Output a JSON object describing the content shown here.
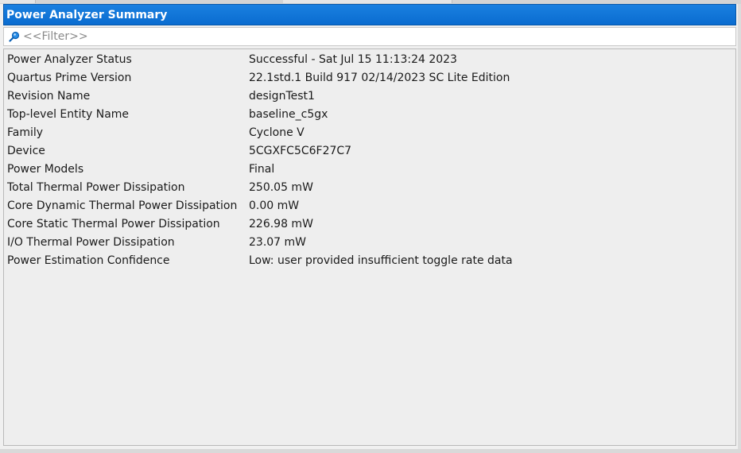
{
  "panel": {
    "title": "Power Analyzer Summary",
    "filter_placeholder": "<<Filter>>",
    "accent_color": "#0a72d6"
  },
  "icons": {
    "filter": "search-icon"
  },
  "summary_rows": [
    {
      "key": "Power Analyzer Status",
      "value": "Successful - Sat Jul 15 11:13:24 2023"
    },
    {
      "key": "Quartus Prime Version",
      "value": "22.1std.1 Build 917 02/14/2023 SC Lite Edition"
    },
    {
      "key": "Revision Name",
      "value": "designTest1"
    },
    {
      "key": "Top-level Entity Name",
      "value": "baseline_c5gx"
    },
    {
      "key": "Family",
      "value": "Cyclone V"
    },
    {
      "key": "Device",
      "value": "5CGXFC5C6F27C7"
    },
    {
      "key": "Power Models",
      "value": "Final"
    },
    {
      "key": "Total Thermal Power Dissipation",
      "value": "250.05 mW"
    },
    {
      "key": "Core Dynamic Thermal Power Dissipation",
      "value": "0.00 mW"
    },
    {
      "key": "Core Static Thermal Power Dissipation",
      "value": "226.98 mW"
    },
    {
      "key": "I/O Thermal Power Dissipation",
      "value": "23.07 mW"
    },
    {
      "key": "Power Estimation Confidence",
      "value": "Low: user provided insufficient toggle rate data"
    }
  ]
}
